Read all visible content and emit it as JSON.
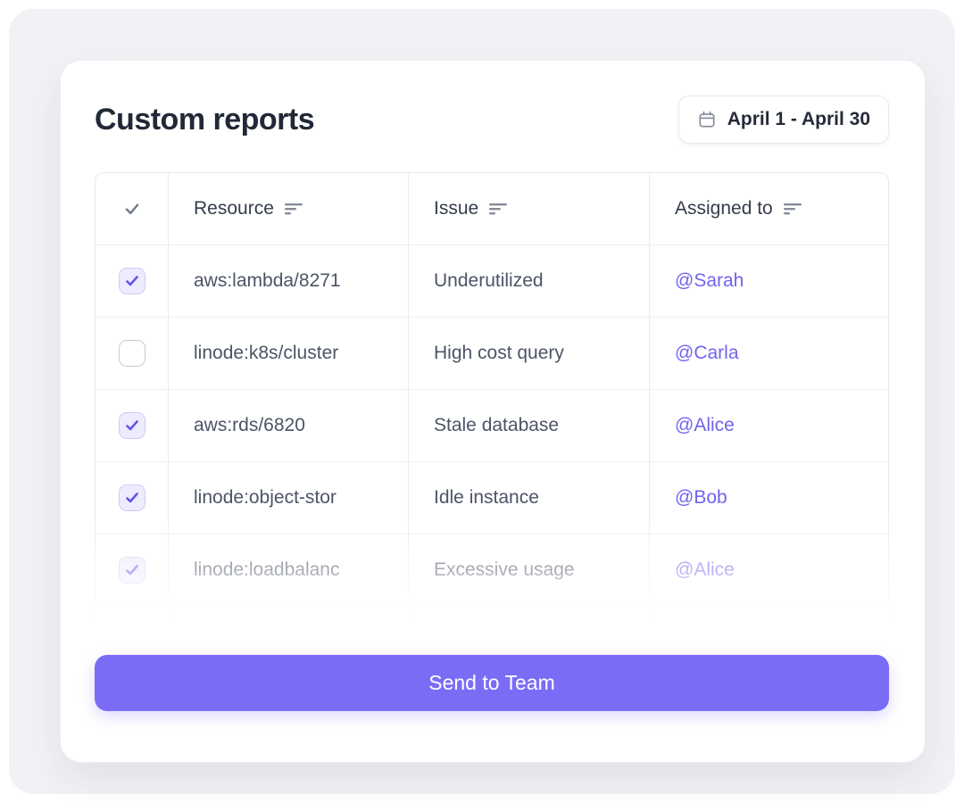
{
  "page": {
    "title": "Custom reports"
  },
  "date_range": {
    "label": "April 1 - April 30",
    "icon": "calendar-icon"
  },
  "table": {
    "headers": {
      "select_icon": "check-icon",
      "resource": "Resource",
      "issue": "Issue",
      "assigned_to": "Assigned to",
      "sort_icon": "sort-lines-icon"
    },
    "rows": [
      {
        "checked": true,
        "resource": "aws:lambda/8271",
        "issue": "Underutilized",
        "assigned": "@Sarah"
      },
      {
        "checked": false,
        "resource": "linode:k8s/cluster",
        "issue": "High cost query",
        "assigned": "@Carla"
      },
      {
        "checked": true,
        "resource": "aws:rds/6820",
        "issue": "Stale database",
        "assigned": "@Alice"
      },
      {
        "checked": true,
        "resource": "linode:object-stor",
        "issue": "Idle instance",
        "assigned": "@Bob"
      },
      {
        "checked": true,
        "resource": "linode:loadbalanc",
        "issue": "Excessive usage",
        "assigned": "@Alice",
        "faded": true
      }
    ],
    "partial_sixth_row_visible": true
  },
  "actions": {
    "send_button": "Send to Team"
  },
  "colors": {
    "accent": "#7b6cf6",
    "assignee_link": "#7163ef",
    "checkbox_checked_bg": "#edebfd",
    "checkbox_check": "#6356e9",
    "card_bg": "#ffffff",
    "stage_bg": "#f1f2f5",
    "header_text": "#343c4c",
    "body_text": "#4c5467"
  }
}
